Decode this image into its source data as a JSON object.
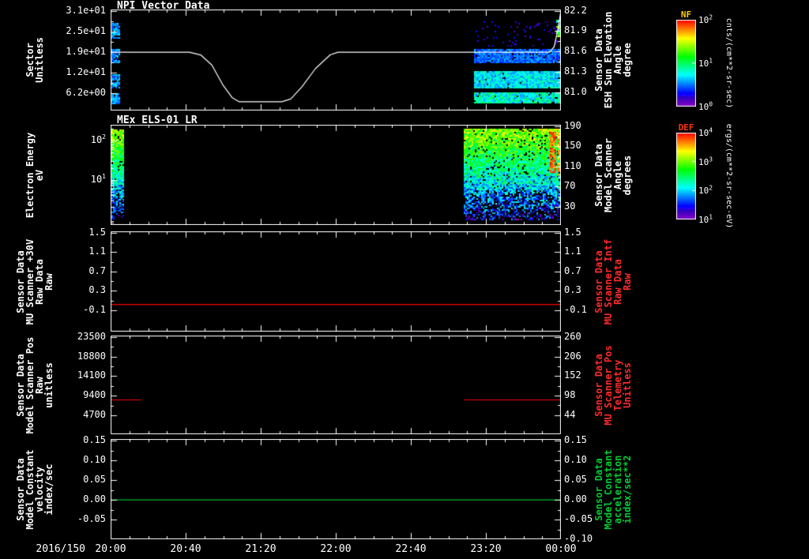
{
  "window": {
    "bg": "#000000"
  },
  "xaxis": {
    "date": "2016/150",
    "tick_labels": [
      "20:00",
      "20:40",
      "21:20",
      "22:00",
      "22:40",
      "23:20",
      "00:00"
    ],
    "hours_span": 4
  },
  "chart_data": [
    {
      "id": "npi-vector-data",
      "type": "heatmap",
      "title": "NPI Vector Data",
      "left_axis": {
        "lines": [
          "Sector",
          "Unitless"
        ],
        "color": "#ffffff",
        "scale": "linear",
        "lim": [
          1.0,
          31.5
        ],
        "ticks": [
          {
            "label": "3.1e+01",
            "value": 31.0
          },
          {
            "label": "2.5e+01",
            "value": 24.8
          },
          {
            "label": "1.9e+01",
            "value": 18.6
          },
          {
            "label": "1.2e+01",
            "value": 12.4
          },
          {
            "label": "6.2e+00",
            "value": 6.2
          }
        ]
      },
      "right_axis": {
        "lines": [
          "Sensor Data",
          "ESH Sun Elevation",
          "Angle",
          "degree"
        ],
        "color": "#ffffff",
        "scale": "linear",
        "lim": [
          80.73,
          82.22
        ],
        "ticks": [
          {
            "label": "82.2",
            "value": 82.2
          },
          {
            "label": "81.9",
            "value": 81.9
          },
          {
            "label": "81.6",
            "value": 81.6
          },
          {
            "label": "81.3",
            "value": 81.3
          },
          {
            "label": "81.0",
            "value": 81.0
          }
        ]
      },
      "lines": [
        {
          "color": "#ffffff",
          "axis": "right",
          "segments": [
            {
              "t": [
                0,
                0.7,
                0.8,
                0.9,
                1.0,
                1.08,
                1.14,
                1.52,
                1.6,
                1.7,
                1.82,
                1.95,
                2.02,
                3.9,
                3.94,
                3.97,
                4.0
              ],
              "v": [
                81.59,
                81.59,
                81.55,
                81.4,
                81.1,
                80.92,
                80.86,
                80.86,
                80.9,
                81.08,
                81.35,
                81.55,
                81.59,
                81.59,
                81.67,
                81.9,
                82.2
              ]
            }
          ]
        }
      ],
      "heatmap_regions": [
        {
          "t": [
            0,
            0.084
          ],
          "frac": [
            0.13,
            0.28
          ],
          "mode": "uniform",
          "val": [
            0.2,
            0.36
          ],
          "density": 0.85
        },
        {
          "t": [
            0,
            0.084
          ],
          "frac": [
            0.39,
            0.52
          ],
          "mode": "uniform",
          "val": [
            0.2,
            0.36
          ],
          "density": 0.85
        },
        {
          "t": [
            0,
            0.084
          ],
          "frac": [
            0.64,
            0.78
          ],
          "mode": "uniform",
          "val": [
            0.2,
            0.36
          ],
          "density": 0.85
        },
        {
          "t": [
            0,
            0.084
          ],
          "frac": [
            0.83,
            0.93
          ],
          "mode": "uniform",
          "val": [
            0.2,
            0.36
          ],
          "density": 0.85
        },
        {
          "t": [
            3.23,
            4.0
          ],
          "frac": [
            0.12,
            0.37
          ],
          "mode": "uniform",
          "val": [
            0.06,
            0.18
          ],
          "density": 0.07
        },
        {
          "t": [
            3.23,
            4.0
          ],
          "frac": [
            0.39,
            0.52
          ],
          "mode": "uniform",
          "val": [
            0.17,
            0.32
          ],
          "density": 0.92
        },
        {
          "t": [
            3.23,
            4.0
          ],
          "frac": [
            0.61,
            0.78
          ],
          "mode": "uniform",
          "val": [
            0.26,
            0.46
          ],
          "density": 0.97
        },
        {
          "t": [
            3.23,
            4.0
          ],
          "frac": [
            0.82,
            0.93
          ],
          "mode": "uniform",
          "val": [
            0.26,
            0.55
          ],
          "density": 0.95
        },
        {
          "t": [
            3.955,
            4.0
          ],
          "frac": [
            0.1,
            0.27
          ],
          "mode": "uniform",
          "val": [
            0.3,
            0.8
          ],
          "density": 0.85
        }
      ],
      "colorbar": {
        "name": "NF",
        "name_color": "#ffcc00",
        "units": "cnts/(cm**2-sr-sec)",
        "tick_labels": [
          "10^2",
          "10^1",
          "10^0"
        ]
      }
    },
    {
      "id": "mex-els-01-lr",
      "type": "heatmap",
      "title": "MEx ELS-01 LR",
      "left_axis": {
        "lines": [
          "Electron Energy",
          "eV"
        ],
        "color": "#ffffff",
        "scale": "log",
        "lim": [
          0.7,
          250
        ],
        "ticks": [
          {
            "label": "10^2",
            "value": 100
          },
          {
            "label": "10^1",
            "value": 10
          }
        ]
      },
      "right_axis": {
        "lines": [
          "Sensor Data",
          "Model Scanner",
          "Angle",
          "degrees"
        ],
        "color": "#ffffff",
        "scale": "linear",
        "lim": [
          -6,
          193
        ],
        "ticks": [
          {
            "label": "190",
            "value": 190
          },
          {
            "label": "150",
            "value": 150
          },
          {
            "label": "110",
            "value": 110
          },
          {
            "label": "70",
            "value": 70
          },
          {
            "label": "30",
            "value": 30
          }
        ]
      },
      "heatmap_regions": [
        {
          "t": [
            0.005,
            0.115
          ],
          "frac": [
            0.05,
            0.94
          ],
          "mode": "vgrad",
          "top": 0.7,
          "bottom": 0.16,
          "noise": 0.13,
          "density": 0.95,
          "fade": true
        },
        {
          "t": [
            3.14,
            4.0
          ],
          "frac": [
            0.04,
            0.95
          ],
          "mode": "vgrad",
          "top": 0.7,
          "bottom": 0.14,
          "noise": 0.15,
          "density": 0.93,
          "fade": true
        },
        {
          "t": [
            3.9,
            3.95
          ],
          "frac": [
            0.07,
            0.48
          ],
          "mode": "uniform",
          "val": [
            0.85,
            1.0
          ],
          "density": 0.85
        },
        {
          "t": [
            3.975,
            4.0
          ],
          "frac": [
            0.08,
            0.5
          ],
          "mode": "uniform",
          "val": [
            0.75,
            0.95
          ],
          "density": 0.8
        }
      ],
      "colorbar": {
        "name": "DEF",
        "name_color": "#ff3300",
        "units": "ergs/(cm**2-sr-sec-eV)",
        "tick_labels": [
          "10^4",
          "10^3",
          "10^2",
          "10^1"
        ]
      }
    },
    {
      "id": "mu-scanner-30v-raw",
      "type": "line",
      "left_axis": {
        "lines": [
          "Sensor Data",
          "MU Scanner +30V",
          "Raw Data",
          "Raw"
        ],
        "color": "#ffffff",
        "scale": "linear",
        "lim": [
          -0.54,
          1.53
        ],
        "ticks": [
          {
            "label": "1.5",
            "value": 1.5
          },
          {
            "label": "1.1",
            "value": 1.1
          },
          {
            "label": "0.7",
            "value": 0.7
          },
          {
            "label": "0.3",
            "value": 0.3
          },
          {
            "label": "-0.1",
            "value": -0.1
          }
        ]
      },
      "right_axis": {
        "lines": [
          "Sensor Data",
          "MU Scanner Intf",
          "Raw Data",
          "Raw"
        ],
        "color": "#ff2a2a",
        "scale": "linear",
        "lim": [
          -0.54,
          1.53
        ],
        "ticks": [
          {
            "label": "1.5",
            "value": 1.5
          },
          {
            "label": "1.1",
            "value": 1.1
          },
          {
            "label": "0.7",
            "value": 0.7
          },
          {
            "label": "0.3",
            "value": 0.3
          },
          {
            "label": "-0.1",
            "value": -0.1
          }
        ]
      },
      "lines": [
        {
          "color": "#ff0000",
          "axis": "left",
          "segments": [
            {
              "t": [
                0,
                4
              ],
              "v": [
                0.02,
                0.02
              ]
            }
          ]
        }
      ]
    },
    {
      "id": "model-scanner-pos-raw",
      "type": "line",
      "left_axis": {
        "lines": [
          "Sensor Data",
          "Model Scanner Pos",
          "Raw",
          "unitless"
        ],
        "color": "#ffffff",
        "scale": "linear",
        "lim": [
          140,
          23880
        ],
        "ticks": [
          {
            "label": "23500",
            "value": 23500
          },
          {
            "label": "18800",
            "value": 18800
          },
          {
            "label": "14100",
            "value": 14100
          },
          {
            "label": "9400",
            "value": 9400
          },
          {
            "label": "4700",
            "value": 4700
          }
        ]
      },
      "right_axis": {
        "lines": [
          "Sensor Data",
          "MU Scanner Pos",
          "Telemetry",
          "Unitless"
        ],
        "color": "#ff2a2a",
        "scale": "linear",
        "lim": [
          -9,
          264
        ],
        "ticks": [
          {
            "label": "260",
            "value": 260
          },
          {
            "label": "206",
            "value": 206
          },
          {
            "label": "152",
            "value": 152
          },
          {
            "label": "98",
            "value": 98
          },
          {
            "label": "44",
            "value": 44
          }
        ]
      },
      "lines": [
        {
          "color": "#ff0000",
          "axis": "left",
          "segments": [
            {
              "t": [
                0,
                0.27
              ],
              "v": [
                8400,
                8400
              ]
            },
            {
              "t": [
                3.14,
                4.0
              ],
              "v": [
                8400,
                8400
              ]
            }
          ]
        }
      ]
    },
    {
      "id": "model-constant-velocity",
      "type": "line",
      "left_axis": {
        "lines": [
          "Sensor Data",
          "Model Constant",
          "velocity",
          "index/sec"
        ],
        "color": "#ffffff",
        "scale": "linear",
        "lim": [
          -0.1,
          0.155
        ],
        "ticks": [
          {
            "label": "0.15",
            "value": 0.15
          },
          {
            "label": "0.10",
            "value": 0.1
          },
          {
            "label": "0.05",
            "value": 0.05
          },
          {
            "label": "0.00",
            "value": 0.0
          },
          {
            "label": "-0.05",
            "value": -0.05
          }
        ]
      },
      "right_axis": {
        "lines": [
          "Sensor Data",
          "Model Constant",
          "acceleration",
          "index/sec**2"
        ],
        "color": "#00cc33",
        "scale": "linear",
        "lim": [
          -0.1,
          0.155
        ],
        "ticks": [
          {
            "label": "0.15",
            "value": 0.15
          },
          {
            "label": "0.10",
            "value": 0.1
          },
          {
            "label": "0.05",
            "value": 0.05
          },
          {
            "label": "0.00",
            "value": 0.0
          },
          {
            "label": "-0.05",
            "value": -0.05
          },
          {
            "label": "-0.10",
            "value": -0.1
          }
        ]
      },
      "lines": [
        {
          "color": "#00bb33",
          "axis": "left",
          "segments": [
            {
              "t": [
                0,
                4
              ],
              "v": [
                0,
                0
              ]
            }
          ]
        }
      ]
    }
  ]
}
